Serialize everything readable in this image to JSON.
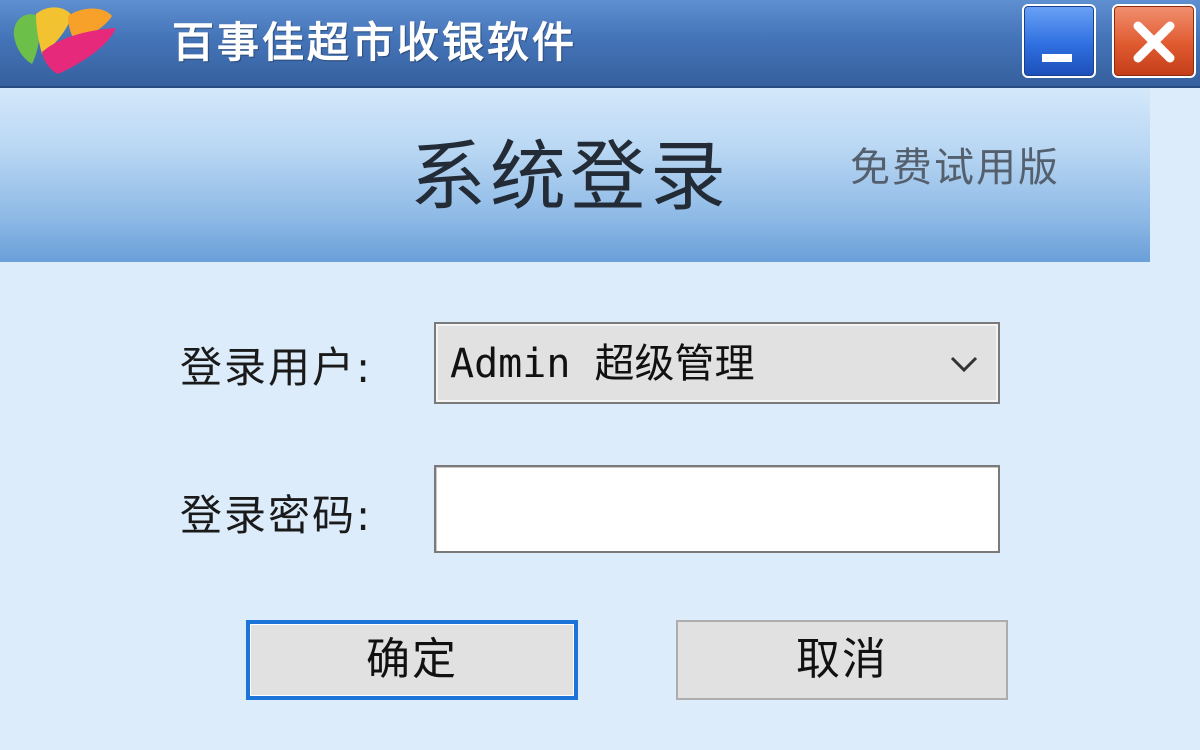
{
  "window": {
    "title": "百事佳超市收银软件",
    "minimize_icon": "minimize-icon",
    "close_icon": "close-icon",
    "logo_icon": "app-logo-icon"
  },
  "header": {
    "heading": "系统登录",
    "edition": "免费试用版"
  },
  "form": {
    "user_label": "登录用户:",
    "user_selected": "Admin 超级管理",
    "password_label": "登录密码:",
    "password_value": ""
  },
  "actions": {
    "ok_label": "确定",
    "cancel_label": "取消"
  },
  "colors": {
    "title_bar": "#4474b8",
    "window_bg": "#dcecfb",
    "focus_border": "#1c74d8",
    "close_button": "#e05a30",
    "minimize_button": "#2f6fe0"
  }
}
